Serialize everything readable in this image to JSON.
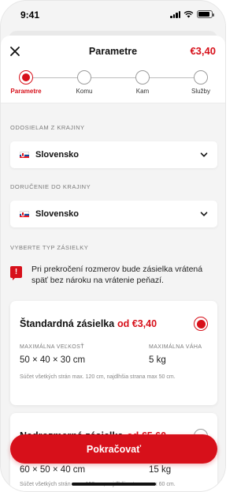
{
  "status_bar": {
    "time": "9:41"
  },
  "header": {
    "title": "Parametre",
    "price": "€3,40"
  },
  "stepper": {
    "steps": [
      {
        "label": "Parametre",
        "active": true
      },
      {
        "label": "Komu",
        "active": false
      },
      {
        "label": "Kam",
        "active": false
      },
      {
        "label": "Služby",
        "active": false
      }
    ]
  },
  "origin": {
    "label": "Odosielam z krajiny",
    "value": "Slovensko"
  },
  "destination": {
    "label": "Doručenie do krajiny",
    "value": "Slovensko"
  },
  "parcel_type": {
    "label": "Vyberte typ zásielky"
  },
  "warning": {
    "text": "Pri prekročení rozmerov bude zásielka vrátená späť bez nároku na vrátenie peňazí."
  },
  "cards": [
    {
      "title": "Štandardná zásielka",
      "price": "od €3,40",
      "selected": true,
      "size_label": "Maximálna veľkosť",
      "size_value": "50 × 40 × 30 cm",
      "weight_label": "Maximálna váha",
      "weight_value": "5 kg",
      "note": "Súčet všetkých strán max. 120 cm, najdlhšia strana max 50 cm."
    },
    {
      "title": "Nadrozmerná zásielka",
      "price": "od €5,60",
      "selected": false,
      "size_value": "60 × 50 × 40 cm",
      "weight_value": "15 kg",
      "note": "Súčet všetkých strán max. 150 cm, najdlhšia strana max 60 cm."
    }
  ],
  "cta": {
    "label": "Pokračovať"
  },
  "colors": {
    "accent": "#d7101a",
    "background": "#f4f4f4",
    "card": "#ffffff",
    "muted": "#7a7a7a"
  },
  "icons": [
    "close-icon",
    "chevron-down-icon",
    "warning-icon",
    "slovakia-flag-icon"
  ]
}
